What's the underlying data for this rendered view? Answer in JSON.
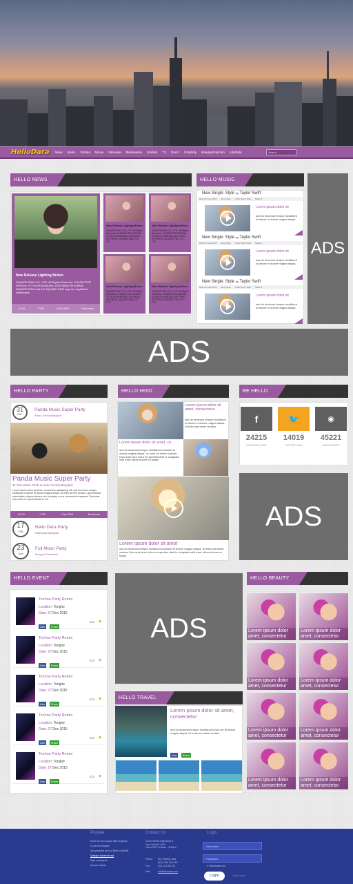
{
  "brand": {
    "logo": "HelloDara",
    "accent": "#9a5aa0",
    "dark": "#333333"
  },
  "nav": {
    "items": [
      "News",
      "Music",
      "Stories",
      "Movie",
      "Interview",
      "Businesses",
      "Stabilot",
      "TV",
      "Event",
      "Celebrity",
      "Beauty&Fashion",
      "LifeStyle"
    ],
    "search_placeholder": "Search"
  },
  "news": {
    "header": "HELLO  NEWS",
    "main": {
      "title": "New Release Lighting Beirun",
      "body": "SQUARE ENIX CO., LTD. All Rights Reserved. CHARACTER DESIGN: TETSUYA NOMURA LIGHTNING RETURNS: SQUARE ENIX and the SQUARE ENIX logo are registered trademarks",
      "stats": [
        "12 VN",
        "9 796",
        "4 Dec 2015",
        "Read more"
      ]
    },
    "small": [
      {
        "title": "New Release Lighting Beirun",
        "body": "SQUARE ENIX CO., LTD. All Rights Reserved. CHARACTER DESIGN: TETSUYA NOMURA LIGHTNING RETURNS: SQUARE ENIX CO., LTD"
      },
      {
        "title": "New Release Lighting Beirun",
        "body": "SQUARE ENIX CO., LTD. All Rights Reserved. CHARACTER DESIGN: TETSUYA NOMURA LIGHTNING RETURNS: SQUARE ENIX CO., LTD"
      },
      {
        "title": "New Release Lighting Beirun",
        "body": "SQUARE ENIX CO., LTD. All Rights Reserved. CHARACTER DESIGN: TETSUYA NOMURA LIGHTNING RETURNS: SQUARE ENIX CO., LTD"
      },
      {
        "title": "New Release Lighting Beirun",
        "body": "SQUARE ENIX CO., LTD. All Rights Reserved. CHARACTER DESIGN: TETSUYA NOMURA LIGHTNING RETURNS: SQUARE ENIX CO., LTD"
      }
    ]
  },
  "music": {
    "header": "HELLO  MUSIC",
    "items": [
      {
        "title": "New Single: Style",
        "by": "by",
        "artist": "Taylor Swift",
        "meta": [
          "Date 15 June 2015",
          "Song Style",
          "Artist Taylor Swift",
          "Share It"
        ],
        "heading": "Lorem ipsum dolor sit",
        "body": "sed do eiusmod tempor incididunt ut labore et dolore magna aliqua."
      },
      {
        "title": "New Single: Style",
        "by": "by",
        "artist": "Taylor Swift",
        "meta": [
          "Date 15 June 2015",
          "Song Style",
          "Artist Taylor Swift",
          "Share It"
        ],
        "heading": "Lorem ipsum dolor sit",
        "body": "sed do eiusmod tempor incididunt ut labore et dolore magna aliqua."
      },
      {
        "title": "New Single: Style",
        "by": "by",
        "artist": "Taylor Swift",
        "meta": [
          "Date 15 June 2015",
          "Song Style",
          "Artist Taylor Swift",
          "Share It"
        ],
        "heading": "Lorem ipsum dolor sit",
        "body": "sed do eiusmod tempor incididunt ut labore et dolore magna aliqua."
      }
    ]
  },
  "ads": {
    "label": "ADS"
  },
  "party": {
    "header": "HELLO  PARTY",
    "featured": {
      "day": "31",
      "month": "DEC",
      "title": "Panda Music Super Party",
      "venue": "Abac Condo Bangkok",
      "big_title": "Panda Music Super Party",
      "date_line": "31 December 2015 at Abac Condo,Bangkok",
      "body": "Lorem ipsum dolor sit amet, consectetur adipiscing elit, sed do eiusm tempor incididunt ut labore et dolore magna aliqua. Ut enim ad min veniam, quis nostrud exercitation ullamco laboris nisi ut aliquip ex ea commodo consequat. Duis aute irure dolor in reprehenderit in vol",
      "stats": [
        "12 VN",
        "9 796",
        "4 Dec 2015",
        "Read more"
      ]
    },
    "others": [
      {
        "day": "17",
        "month": "FEB",
        "title": "Hello Dara Party",
        "venue": "Ratchada Bangkok"
      },
      {
        "day": "23",
        "month": "June",
        "title": "Full Moon Party",
        "venue": "Pangan Suratthani"
      }
    ]
  },
  "hiso": {
    "header": "HELLO  HISO",
    "a": {
      "heading": "Lorem ipsum dolor sit amet, consectetur",
      "body": "sed do eiusmod tempor incididunt ut labore et dolore magna aliqua. Ut enim ad minim veniam"
    },
    "b": {
      "heading": "Lorem ipsum dolor sit amet, co",
      "body": "sed do eiusmod tempor incididunt ut labore et dolore magna aliqua. Ut enim ad minim veniam Duis aute irure dolor in reprehenderit in voluptate velit esse cillum dolore eu fugiat"
    },
    "c": {
      "heading": "Lorem ipsum dolor sit amet",
      "body": "sed do eiusmod tempor incididunt ut labore et dolore magna aliqua. Ut enim ad minim veniam Duis aute irure dolor in reprehen derit in voluptate velit esse cillum dolore eu fugiat"
    }
  },
  "behello": {
    "header": "BE HELLO",
    "social": [
      {
        "icon": "facebook-icon",
        "glyph": "f",
        "count": "24215",
        "label": "FACEBOOK FANS",
        "color": "#5f5f5f"
      },
      {
        "icon": "twitter-icon",
        "glyph": "🐦",
        "count": "14019",
        "label": "TWITTER FANS",
        "color": "#f3a521"
      },
      {
        "icon": "rss-icon",
        "glyph": "◉",
        "count": "45221",
        "label": "SUBSCRIBERS",
        "color": "#5f5f5f"
      }
    ]
  },
  "event": {
    "header": "HELLO  EVENT",
    "items": [
      {
        "title": "Techno Party Remix",
        "loc_label": "Location:",
        "loc": "Tonglor",
        "date_label": "Date:",
        "day": "27",
        "date": "Dec 2015",
        "like": "Like",
        "share": "Share",
        "count": "412"
      },
      {
        "title": "Techno Party Remix",
        "loc_label": "Location:",
        "loc": "Tonglor",
        "date_label": "Date:",
        "day": "27",
        "date": "Dec 2015",
        "like": "Like",
        "share": "Share",
        "count": "413"
      },
      {
        "title": "Techno Party Remix",
        "loc_label": "Location:",
        "loc": "Tonglor",
        "date_label": "Date:",
        "day": "27",
        "date": "Dec 2015",
        "like": "Like",
        "share": "Share",
        "count": "412"
      },
      {
        "title": "Techno Party Remix",
        "loc_label": "Location:",
        "loc": "Tonglor",
        "date_label": "Date:",
        "day": "27",
        "date": "Dec 2015",
        "like": "Like",
        "share": "Share",
        "count": "412"
      },
      {
        "title": "Techno Party Remix",
        "loc_label": "Location:",
        "loc": "Tonglor",
        "date_label": "Date:",
        "day": "27",
        "date": "Dec 2015",
        "like": "Like",
        "share": "Share",
        "count": "412"
      }
    ]
  },
  "travel": {
    "header": "HELLO  TRAVEL",
    "heading": "Lorem ipsum dolor sit amet, consectetur",
    "body": "sed do eiusmod tempor incididunt ut lab ore et dolore magna aliqua. Ut enim ad minim veniam",
    "like": "Like",
    "share": "Share"
  },
  "beauty": {
    "header": "HELLO  BEAUTY",
    "caption": "Lorem ipsum dolor amet, consectetur"
  },
  "footer": {
    "popular_title": "Popular",
    "popular": [
      "Morbi sit eros neque diam dapibus",
      "A velit est tristique",
      "Sed pharetra eros ut libero molestie",
      "Quisque laoreet in est",
      "Eget consequat",
      "Aenean iaculis"
    ],
    "contact_title": "Contact Us",
    "address": [
      "213 E Street Suite 3400 S",
      "New York,NY USA",
      "Hours EST: 8:00am - 5:00pm"
    ],
    "phone_label": "Phone",
    "phone": "(01) 480914 3A5",
    "phone2": "(642) 330 234 918",
    "fax_label": "Fax",
    "fax": "(20) 234-432-41",
    "mail_label": "Mail",
    "mail": "info@itempas.com",
    "login_title": "Login",
    "username_placeholder": "Username",
    "password_placeholder": "Password",
    "remember": "Remember me",
    "login_button": "Login",
    "forgot": "Forgot login?"
  }
}
